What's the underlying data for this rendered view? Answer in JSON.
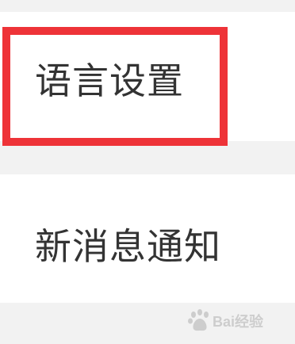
{
  "settings": {
    "items": [
      {
        "label": "语言设置"
      },
      {
        "label": "新消息通知"
      }
    ]
  },
  "annotation": {
    "color": "#ee3338",
    "target": "语言设置"
  },
  "watermark": {
    "text": "Bai经验"
  }
}
